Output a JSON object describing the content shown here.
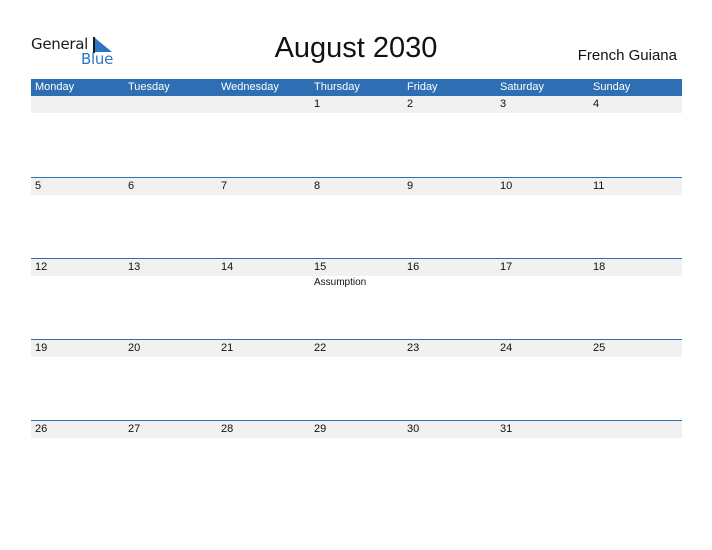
{
  "logo": {
    "line1": "General",
    "line2": "Blue"
  },
  "title": "August 2030",
  "country": "French Guiana",
  "colors": {
    "accent": "#2e6fb3",
    "band": "#f1f1f1"
  },
  "weekdays": [
    "Monday",
    "Tuesday",
    "Wednesday",
    "Thursday",
    "Friday",
    "Saturday",
    "Sunday"
  ],
  "weeks": [
    {
      "days": [
        "",
        "",
        "",
        "1",
        "2",
        "3",
        "4"
      ],
      "events": [
        "",
        "",
        "",
        "",
        "",
        "",
        ""
      ]
    },
    {
      "days": [
        "5",
        "6",
        "7",
        "8",
        "9",
        "10",
        "11"
      ],
      "events": [
        "",
        "",
        "",
        "",
        "",
        "",
        ""
      ]
    },
    {
      "days": [
        "12",
        "13",
        "14",
        "15",
        "16",
        "17",
        "18"
      ],
      "events": [
        "",
        "",
        "",
        "Assumption",
        "",
        "",
        ""
      ]
    },
    {
      "days": [
        "19",
        "20",
        "21",
        "22",
        "23",
        "24",
        "25"
      ],
      "events": [
        "",
        "",
        "",
        "",
        "",
        "",
        ""
      ]
    },
    {
      "days": [
        "26",
        "27",
        "28",
        "29",
        "30",
        "31",
        ""
      ],
      "events": [
        "",
        "",
        "",
        "",
        "",
        "",
        ""
      ]
    }
  ]
}
